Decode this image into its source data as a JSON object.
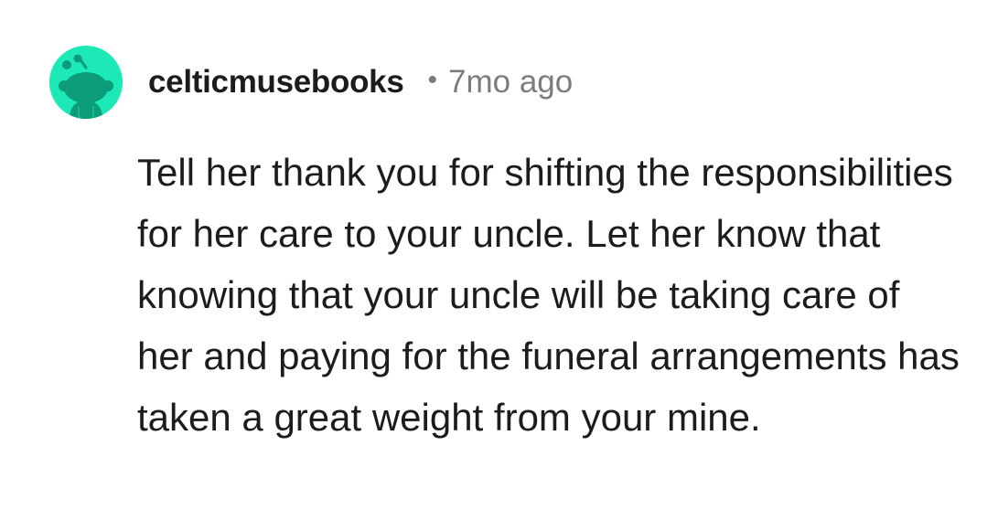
{
  "comment": {
    "avatar_icon": "reddit-snoo-avatar-icon",
    "avatar_color": "#1de9b6",
    "username": "celticmusebooks",
    "separator": "•",
    "timestamp": "7mo ago",
    "body": "Tell her thank you for shifting the responsibilities for her care to your uncle. Let her know that knowing that your uncle will be taking care of her and paying for the funeral arrangements has taken a great weight from your mine."
  }
}
